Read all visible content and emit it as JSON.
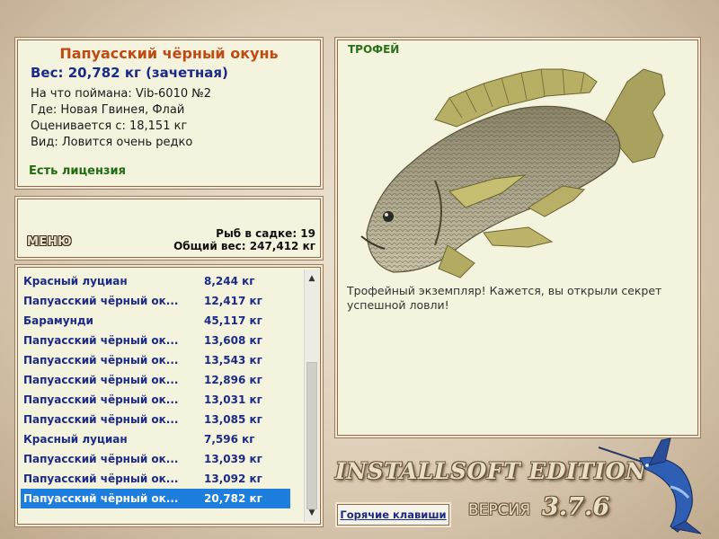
{
  "info": {
    "fish_name": "Папуасский чёрный окунь",
    "weight": "Вес: 20,782 кг (зачетная)",
    "bait": "На что поймана: Vib-6010 №2",
    "location": "Где: Новая Гвинея, Флай",
    "valued_from": "Оценивается с: 18,151 кг",
    "rarity": "Вид: Ловится очень редко",
    "license": "Есть лицензия"
  },
  "stats": {
    "menu_label": "МЕНЮ",
    "fish_in_keepnet": "Рыб в садке: 19",
    "total_weight": "Общий вес: 247,412 кг"
  },
  "catch_list": [
    {
      "name": "Красный луциан",
      "weight": "8,244 кг"
    },
    {
      "name": "Папуасский чёрный ок...",
      "weight": "12,417 кг"
    },
    {
      "name": "Барамунди",
      "weight": "45,117 кг"
    },
    {
      "name": "Папуасский чёрный ок...",
      "weight": "13,608 кг"
    },
    {
      "name": "Папуасский чёрный ок...",
      "weight": "13,543 кг"
    },
    {
      "name": "Папуасский чёрный ок...",
      "weight": "12,896 кг"
    },
    {
      "name": "Папуасский чёрный ок...",
      "weight": "13,031 кг"
    },
    {
      "name": "Папуасский чёрный ок...",
      "weight": "13,085 кг"
    },
    {
      "name": "Красный луциан",
      "weight": "7,596 кг"
    },
    {
      "name": "Папуасский чёрный ок...",
      "weight": "13,039 кг"
    },
    {
      "name": "Папуасский чёрный ок...",
      "weight": "13,092 кг"
    },
    {
      "name": "Папуасский чёрный ок...",
      "weight": "20,782 кг"
    }
  ],
  "selected_index": 11,
  "trophy": {
    "label": "ТРОФЕЙ",
    "text": "Трофейный экземпляр! Кажется, вы открыли секрет успешной ловли!"
  },
  "footer": {
    "hotkeys": "Горячие клавиши",
    "edition": "INSTALLSOFT EDITION",
    "version_label": "ВЕРСИЯ",
    "version": "3.7.6"
  },
  "colors": {
    "selection": "#1e7ede",
    "fish_name": "#c04a12",
    "link_blue": "#1b2a86",
    "license_green": "#1f6c10"
  }
}
